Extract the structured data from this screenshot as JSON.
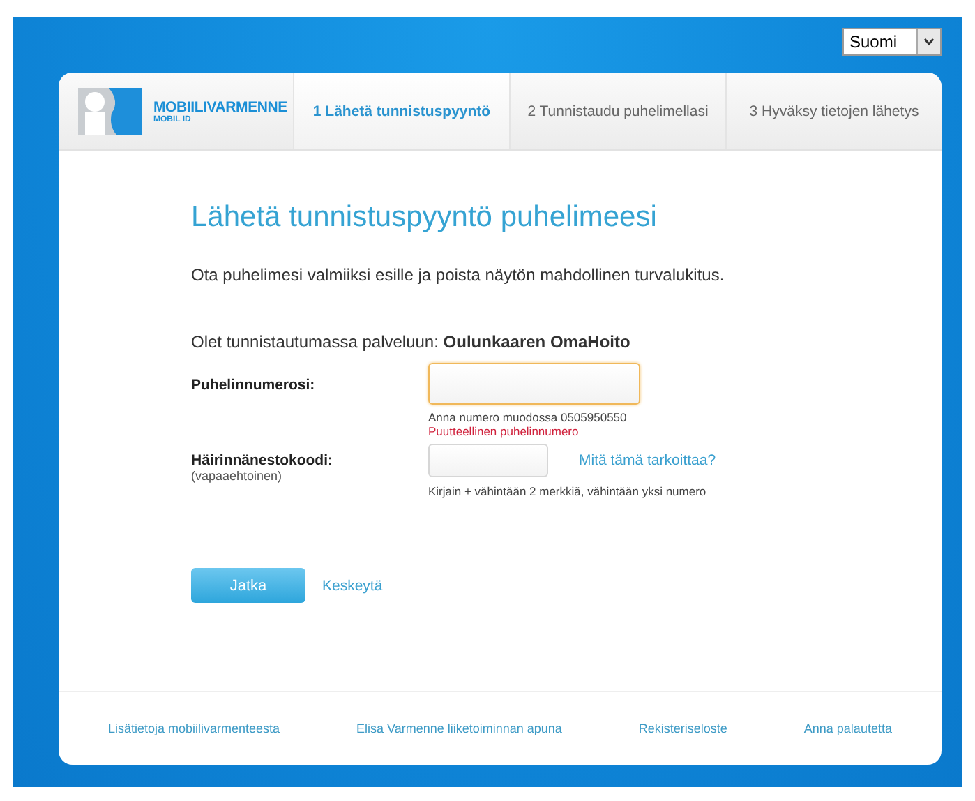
{
  "language_select": {
    "value": "Suomi"
  },
  "logo": {
    "title": "MOBIILIVARMENNE",
    "subtitle": "MOBIL ID"
  },
  "steps": [
    {
      "label": "1 Lähetä tunnistuspyyntö",
      "selected": true
    },
    {
      "label": "2 Tunnistaudu puhelimellasi",
      "selected": false
    },
    {
      "label": "3 Hyväksy tietojen lähetys",
      "selected": false
    }
  ],
  "heading": "Lähetä tunnistuspyyntö puhelimeesi",
  "instruction": "Ota puhelimesi valmiiksi esille ja poista näytön mahdollinen turvalukitus.",
  "service_line": "Olet tunnistautumassa palveluun: **Oulunkaaren OmaHoito**",
  "phone": {
    "label": "Puhelinnumerosi:",
    "focused": true,
    "hint": "Anna numero muodossa 0505950550",
    "error": "Puutteellinen puhelinnumero"
  },
  "code": {
    "label": "Häirinnänestokoodi:",
    "sublabel": "(vapaaehtoinen)",
    "help_link": "Mitä tämä tarkoittaa?",
    "hint": "Kirjain + vähintään 2 merkkiä, vähintään yksi numero"
  },
  "buttons": {
    "continue": "Jatka",
    "cancel": "Keskeytä"
  },
  "footer_links": [
    "Lisätietoja mobiilivarmenteesta",
    "Elisa Varmenne liiketoiminnan apuna",
    "Rekisteriseloste",
    "Anna palautetta"
  ]
}
